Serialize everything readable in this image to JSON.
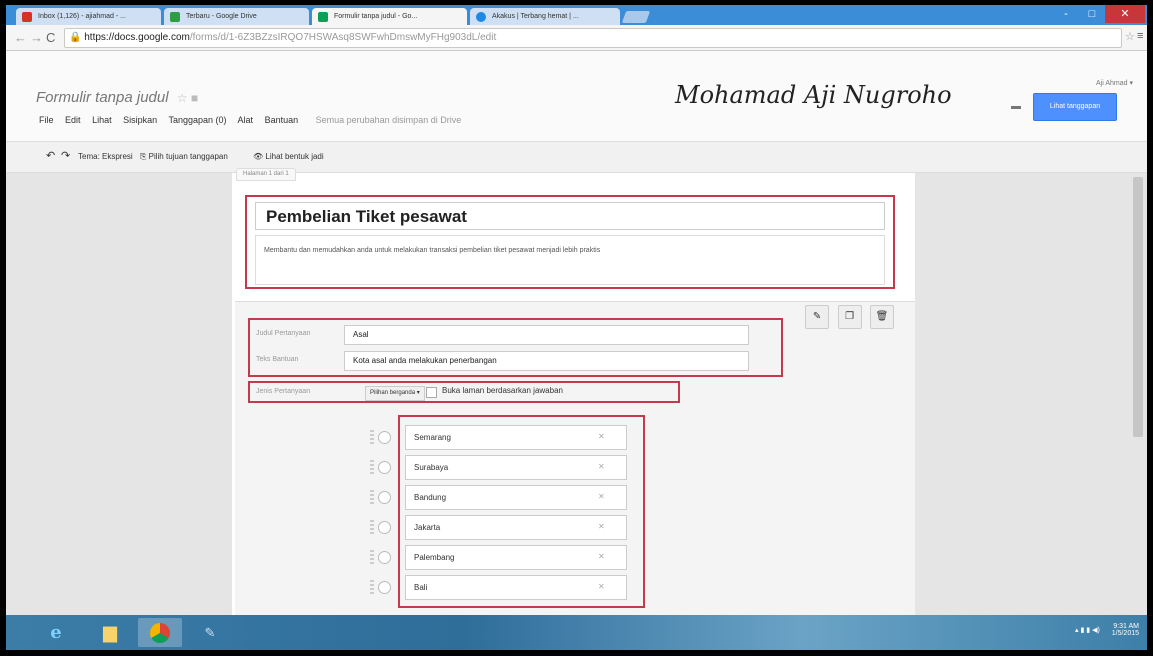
{
  "browser": {
    "tabs": [
      {
        "label": "Inbox (1,126) - ajiahmad - ...",
        "color": "#d93025",
        "active": false
      },
      {
        "label": "Terbaru - Google Drive",
        "color": "#2e9e44",
        "active": false
      },
      {
        "label": "Formulir tanpa judul - Go...",
        "color": "#0f9d58",
        "active": true
      },
      {
        "label": "Akakus | Terbang hemat | ...",
        "color": "#1e88e5",
        "active": false
      }
    ],
    "url_host": "https://docs.google.com",
    "url_rest": "/forms/d/1-6Z3BZzsIRQO7HSWAsq8SWFwhDmswMyFHg903dL/edit",
    "window_controls": [
      "-",
      "□",
      "✕"
    ]
  },
  "form_header": {
    "doc_title": "Formulir tanpa judul",
    "menu": [
      "File",
      "Edit",
      "Lihat",
      "Sisipkan",
      "Tanggapan (0)",
      "Alat",
      "Bantuan"
    ],
    "saved_status": "Semua perubahan disimpan di Drive",
    "author_name": "Mohamad Aji Nugroho",
    "account": "Aji Ahmad ▾",
    "responses_button": "Lihat tanggapan"
  },
  "toolbar": {
    "undo": "↶",
    "redo": "↷",
    "theme": "Tema: Ekspresi",
    "destination": "Pilih tujuan tanggapan",
    "view_live": "Lihat bentuk jadi"
  },
  "page": {
    "page_tab": "Halaman 1 dari 1",
    "title": "Pembelian Tiket pesawat",
    "description": "Membantu dan memudahkan anda untuk melakukan transaksi pembelian tiket pesawat menjadi lebih praktis"
  },
  "question": {
    "title_label": "Judul Pertanyaan",
    "title_value": "Asal",
    "help_label": "Teks Bantuan",
    "help_value": "Kota asal anda melakukan penerbangan",
    "type_label": "Jenis Pertanyaan",
    "type_value": "Pilihan berganda ▾",
    "branch_label": "Buka laman berdasarkan jawaban",
    "options": [
      "Semarang",
      "Surabaya",
      "Bandung",
      "Jakarta",
      "Palembang",
      "Bali"
    ]
  },
  "taskbar": {
    "time": "9:31 AM",
    "date": "1/5/2015"
  }
}
